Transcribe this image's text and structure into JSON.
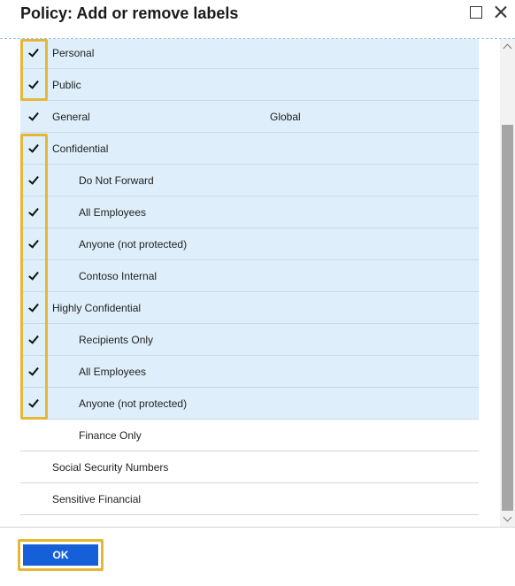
{
  "dialog": {
    "title": "Policy: Add or remove labels",
    "maximize_icon": "maximize-icon",
    "close_icon": "close-icon"
  },
  "labels": [
    {
      "name": "Personal",
      "scope": "",
      "level": 0,
      "checked": true
    },
    {
      "name": "Public",
      "scope": "",
      "level": 0,
      "checked": true
    },
    {
      "name": "General",
      "scope": "Global",
      "level": 0,
      "checked": true
    },
    {
      "name": "Confidential",
      "scope": "",
      "level": 0,
      "checked": true
    },
    {
      "name": "Do Not Forward",
      "scope": "",
      "level": 1,
      "checked": true
    },
    {
      "name": "All Employees",
      "scope": "",
      "level": 1,
      "checked": true
    },
    {
      "name": "Anyone (not protected)",
      "scope": "",
      "level": 1,
      "checked": true
    },
    {
      "name": "Contoso Internal",
      "scope": "",
      "level": 1,
      "checked": true
    },
    {
      "name": "Highly Confidential",
      "scope": "",
      "level": 0,
      "checked": true
    },
    {
      "name": "Recipients Only",
      "scope": "",
      "level": 1,
      "checked": true
    },
    {
      "name": "All Employees",
      "scope": "",
      "level": 1,
      "checked": true
    },
    {
      "name": "Anyone (not protected)",
      "scope": "",
      "level": 1,
      "checked": true
    },
    {
      "name": "Finance Only",
      "scope": "",
      "level": 1,
      "checked": false
    },
    {
      "name": "Social Security Numbers",
      "scope": "",
      "level": 0,
      "checked": false
    },
    {
      "name": "Sensitive Financial",
      "scope": "",
      "level": 0,
      "checked": false
    }
  ],
  "footer": {
    "ok_label": "OK"
  },
  "colors": {
    "selected_row": "#deeefa",
    "highlight": "#e6b735",
    "ok_button": "#1560d8"
  }
}
